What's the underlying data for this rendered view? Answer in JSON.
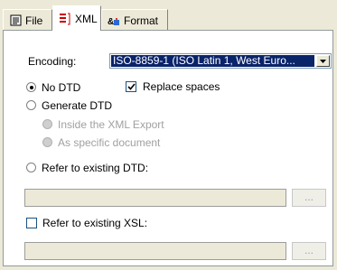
{
  "tabs": [
    {
      "label": "File",
      "icon": "document-icon"
    },
    {
      "label": "XML",
      "icon": "xml-icon"
    },
    {
      "label": "Format",
      "icon": "format-icon"
    }
  ],
  "encoding": {
    "label": "Encoding:",
    "value": "ISO-8859-1 (ISO Latin 1, West Euro..."
  },
  "dtd": {
    "no_dtd": "No DTD",
    "generate_dtd": "Generate DTD",
    "inside_export": "Inside the XML Export",
    "as_specific": "As specific document",
    "refer_existing": "Refer to existing DTD:",
    "dtd_path": "",
    "browse": "..."
  },
  "replace_spaces": "Replace spaces",
  "xsl": {
    "refer_existing": "Refer to existing XSL:",
    "xsl_path": "",
    "browse": "..."
  },
  "colors": {
    "selection": "#0a246a",
    "panel": "#ffffff",
    "dialog": "#ece9d8"
  }
}
